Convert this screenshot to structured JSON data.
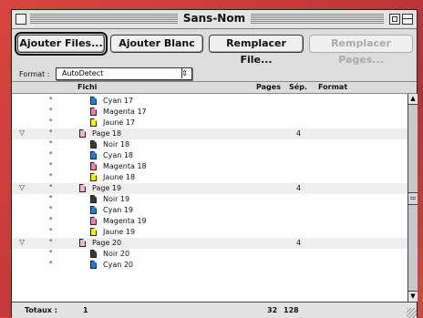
{
  "window": {
    "title": "Sans-Nom"
  },
  "toolbar": {
    "add_files": "Ajouter Files...",
    "add_blank": "Ajouter Blanc",
    "replace_file": "Remplacer File...",
    "replace_pages": "Remplacer Pages..."
  },
  "format": {
    "label": "Format :",
    "value": "AutoDetect"
  },
  "columns": {
    "file": "Fichi",
    "pages": "Pages",
    "sep": "Sép.",
    "format": "Format"
  },
  "rows": [
    {
      "kind": "sep",
      "name": "Cyan 17",
      "icon": "cyan"
    },
    {
      "kind": "sep",
      "name": "Magenta 17",
      "icon": "magenta"
    },
    {
      "kind": "sep",
      "name": "Jaune 17",
      "icon": "yellow"
    },
    {
      "kind": "page",
      "name": "Page 18",
      "icon": "page",
      "sep": "4"
    },
    {
      "kind": "sep",
      "name": "Noir 18",
      "icon": "black"
    },
    {
      "kind": "sep",
      "name": "Cyan 18",
      "icon": "cyan"
    },
    {
      "kind": "sep",
      "name": "Magenta 18",
      "icon": "magenta"
    },
    {
      "kind": "sep",
      "name": "Jaune 18",
      "icon": "yellow"
    },
    {
      "kind": "page",
      "name": "Page 19",
      "icon": "page",
      "sep": "4"
    },
    {
      "kind": "sep",
      "name": "Noir 19",
      "icon": "black"
    },
    {
      "kind": "sep",
      "name": "Cyan 19",
      "icon": "cyan"
    },
    {
      "kind": "sep",
      "name": "Magenta 19",
      "icon": "magenta"
    },
    {
      "kind": "sep",
      "name": "Jaune 19",
      "icon": "yellow"
    },
    {
      "kind": "page",
      "name": "Page 20",
      "icon": "page",
      "sep": "4"
    },
    {
      "kind": "sep",
      "name": "Noir 20",
      "icon": "black"
    },
    {
      "kind": "sep",
      "name": "Cyan 20",
      "icon": "cyan"
    }
  ],
  "footer": {
    "label": "Totaux :",
    "files": "1",
    "pages": "32",
    "sep": "128"
  },
  "colors": {
    "black": "#3a3a3a",
    "cyan": "#1a7fd6",
    "magenta": "#f07ab0",
    "yellow": "#ffee00",
    "page": "#f2b8c4"
  },
  "icons": {
    "expand": "disclosure-triangle-icon",
    "bullet": "bullet-icon"
  }
}
